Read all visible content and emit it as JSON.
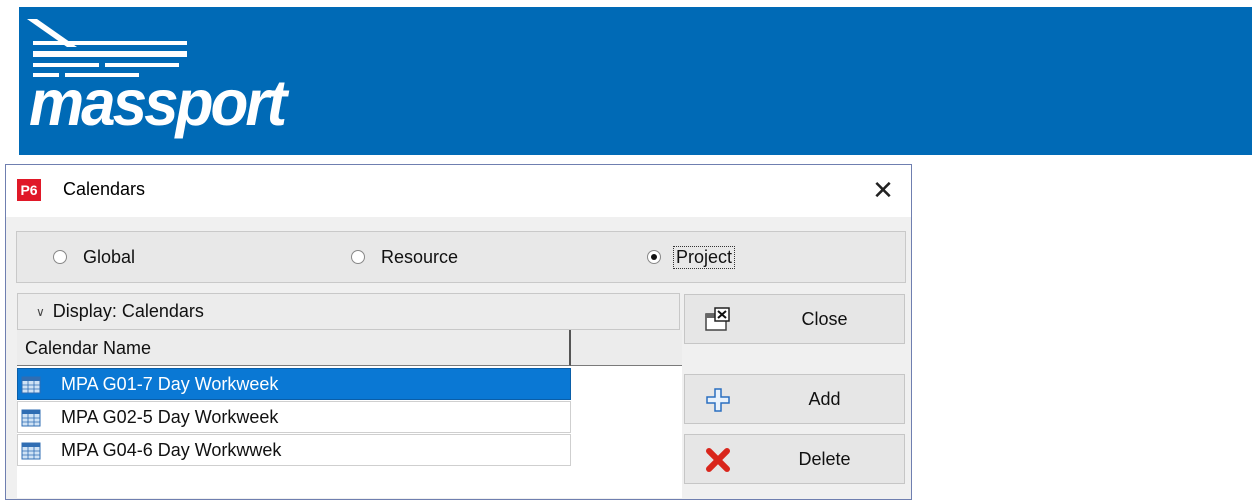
{
  "banner": {
    "logo_text": "massport",
    "color": "#006ab6"
  },
  "dialog": {
    "app_badge": "P6",
    "title": "Calendars",
    "close_glyph": "✕",
    "scope_options": [
      {
        "label": "Global",
        "selected": false
      },
      {
        "label": "Resource",
        "selected": false
      },
      {
        "label": "Project",
        "selected": true
      }
    ],
    "display_label": "Display: Calendars",
    "table": {
      "columns": [
        "Calendar Name"
      ],
      "rows": [
        {
          "name": "MPA G01-7 Day Workweek",
          "selected": true,
          "icon": "calendar-icon"
        },
        {
          "name": "MPA G02-5 Day Workweek",
          "selected": false,
          "icon": "calendar-icon"
        },
        {
          "name": "MPA G04-6 Day Workwwek",
          "selected": false,
          "icon": "calendar-icon"
        }
      ]
    },
    "buttons": {
      "close": {
        "label": "Close",
        "icon": "close-window-icon"
      },
      "add": {
        "label": "Add",
        "icon": "plus-icon"
      },
      "delete": {
        "label": "Delete",
        "icon": "red-x-icon"
      }
    },
    "colors": {
      "selection": "#0a78d4",
      "p6_red": "#e01828"
    }
  }
}
